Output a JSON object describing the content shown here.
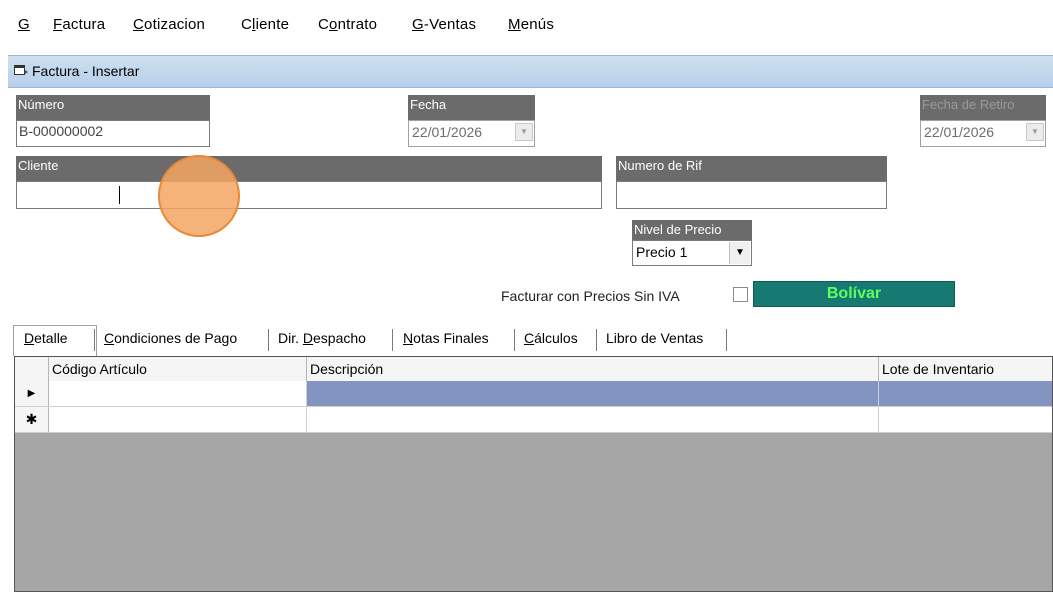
{
  "menu": {
    "items": [
      {
        "pre": "",
        "u": "G",
        "post": ""
      },
      {
        "pre": "",
        "u": "F",
        "post": "actura"
      },
      {
        "pre": "",
        "u": "C",
        "post": "otizacion"
      },
      {
        "pre": "C",
        "u": "l",
        "post": "iente"
      },
      {
        "pre": "C",
        "u": "o",
        "post": "ntrato"
      },
      {
        "pre": "",
        "u": "G",
        "post": "-Ventas"
      },
      {
        "pre": "",
        "u": "M",
        "post": "enús"
      }
    ]
  },
  "window": {
    "title": "Factura - Insertar"
  },
  "form": {
    "numero_label": "Número",
    "numero_value": "B-000000002",
    "fecha_label": "Fecha",
    "fecha_value": "22/01/2026",
    "fecha_retiro_label": "Fecha de Retiro",
    "fecha_retiro_value": "22/01/2026",
    "cliente_label": "Cliente",
    "cliente_value": "",
    "rif_label": "Numero de Rif",
    "rif_value": "",
    "nivel_precio_label": "Nivel de Precio",
    "nivel_precio_value": "Precio 1",
    "sin_iva_label": "Facturar con Precios Sin IVA",
    "sin_iva_checked": false,
    "currency_label": "Bolívar"
  },
  "tabs": [
    {
      "pre": "",
      "u": "D",
      "post": "etalle"
    },
    {
      "pre": "",
      "u": "C",
      "post": "ondiciones de Pago"
    },
    {
      "pre": "Dir. ",
      "u": "D",
      "post": "espacho"
    },
    {
      "pre": "",
      "u": "N",
      "post": "otas Finales"
    },
    {
      "pre": "",
      "u": "C",
      "post": "álculos"
    },
    {
      "pre": "Libro de Ventas",
      "u": "",
      "post": ""
    }
  ],
  "grid": {
    "columns": [
      "Código Artículo",
      "Descripción",
      "Lote de Inventario"
    ],
    "row_markers": [
      "▶",
      "✱"
    ]
  },
  "colors": {
    "currency_bg": "#167a72",
    "currency_text": "#5dff5d",
    "selected_cell": "#8494c0",
    "label_bg": "#6b6b6b"
  }
}
